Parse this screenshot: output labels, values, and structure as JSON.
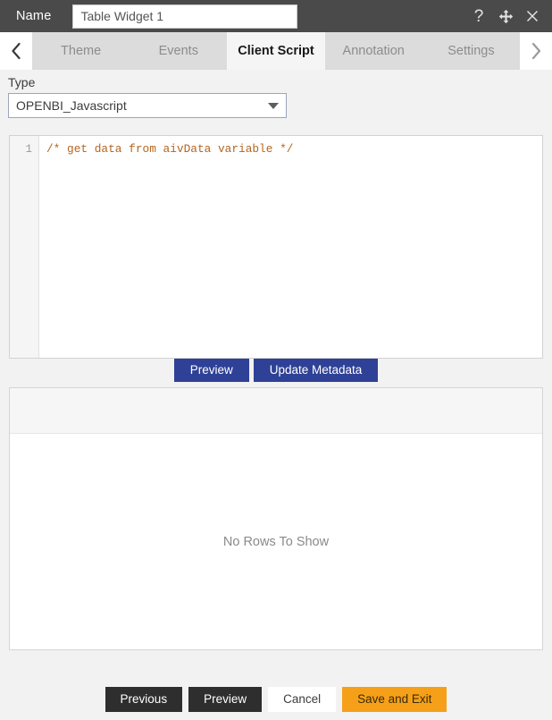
{
  "titlebar": {
    "name_label": "Name",
    "name_value": "Table Widget 1",
    "name_placeholder": "Name",
    "help_icon": "question-mark-icon",
    "move_icon": "move-arrows-icon",
    "close_icon": "close-x-icon"
  },
  "tabbar": {
    "prev_arrow": "‹",
    "next_arrow": "›",
    "tabs": [
      {
        "label": "Theme",
        "active": false
      },
      {
        "label": "Events",
        "active": false
      },
      {
        "label": "Client Script",
        "active": true
      },
      {
        "label": "Annotation",
        "active": false
      },
      {
        "label": "Settings",
        "active": false
      }
    ]
  },
  "form": {
    "type_label": "Type",
    "type_value": "OPENBI_Javascript",
    "type_caret_icon": "chevron-down-icon"
  },
  "editor": {
    "line_numbers": [
      "1"
    ],
    "lines": [
      "/* get data from aivData variable */"
    ],
    "comment_color": "#b5651d"
  },
  "editor_actions": {
    "preview_label": "Preview",
    "update_metadata_label": "Update Metadata",
    "button_color": "#2f4196"
  },
  "result_panel": {
    "empty_message": "No Rows To Show"
  },
  "footer": {
    "previous_label": "Previous",
    "preview_label": "Preview",
    "cancel_label": "Cancel",
    "save_exit_label": "Save and Exit",
    "save_exit_color": "#f6a01a"
  }
}
